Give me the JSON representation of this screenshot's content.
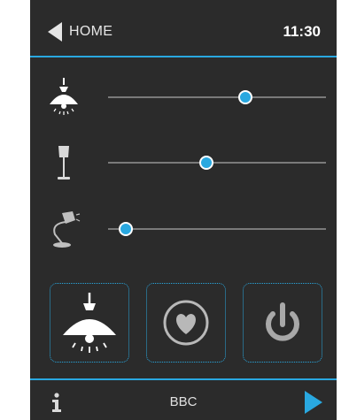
{
  "header": {
    "home_label": "HOME",
    "time": "11:30"
  },
  "lights": [
    {
      "icon": "pendant-lamp-icon",
      "level": 0.63
    },
    {
      "icon": "floor-lamp-icon",
      "level": 0.45
    },
    {
      "icon": "desk-lamp-icon",
      "level": 0.08
    }
  ],
  "buttons": [
    {
      "icon": "pendant-lamp-icon",
      "name": "lights-scene-button"
    },
    {
      "icon": "heart-icon",
      "name": "favorite-button"
    },
    {
      "icon": "power-icon",
      "name": "power-button"
    }
  ],
  "footer": {
    "source_label": "BBC"
  },
  "colors": {
    "accent": "#29a8e0",
    "panel_bg": "#2b2b2b",
    "track": "#7a7a7a"
  }
}
